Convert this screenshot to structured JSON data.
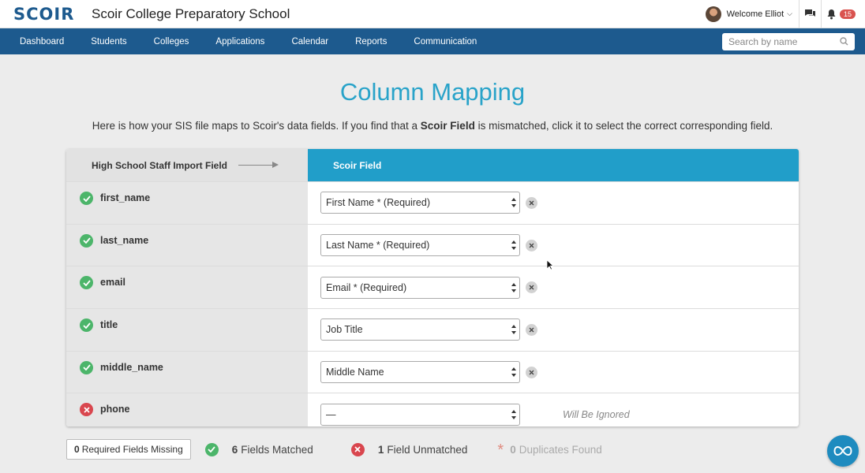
{
  "header": {
    "logo": "SCOIR",
    "school_name": "Scoir College Preparatory School",
    "welcome": "Welcome Elliot",
    "notification_count": "15"
  },
  "nav": {
    "items": [
      "Dashboard",
      "Students",
      "Colleges",
      "Applications",
      "Calendar",
      "Reports",
      "Communication"
    ],
    "search_placeholder": "Search by name"
  },
  "page": {
    "title": "Column Mapping",
    "description_pre": "Here is how your SIS file maps to Scoir's data fields. If you find that a ",
    "description_bold": "Scoir Field",
    "description_post": " is mismatched, click it to select the correct corresponding field."
  },
  "table": {
    "left_header": "High School Staff Import Field",
    "right_header": "Scoir Field",
    "rows": [
      {
        "field": "first_name",
        "status": "matched",
        "mapped": "First Name * (Required)"
      },
      {
        "field": "last_name",
        "status": "matched",
        "mapped": "Last Name * (Required)"
      },
      {
        "field": "email",
        "status": "matched",
        "mapped": "Email * (Required)"
      },
      {
        "field": "title",
        "status": "matched",
        "mapped": "Job Title"
      },
      {
        "field": "middle_name",
        "status": "matched",
        "mapped": "Middle Name"
      },
      {
        "field": "phone",
        "status": "unmatched",
        "mapped": "—",
        "note": "Will Be Ignored"
      }
    ]
  },
  "summary": {
    "required_missing_count": "0",
    "required_missing_label": "Required Fields Missing",
    "matched_count": "6",
    "matched_label": "Fields Matched",
    "unmatched_count": "1",
    "unmatched_label": "Field Unmatched",
    "duplicates_count": "0",
    "duplicates_label": "Duplicates Found"
  },
  "colors": {
    "brand": "#1d5a8e",
    "accent": "#219ec9",
    "success": "#4cb56a",
    "error": "#d9464e"
  }
}
